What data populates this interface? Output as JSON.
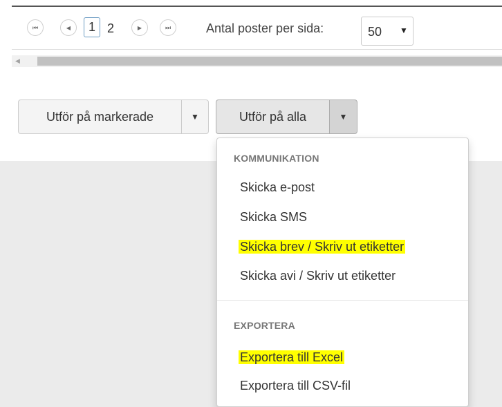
{
  "pager": {
    "first_label": "⏮",
    "prev_label": "◀",
    "page_current": "1",
    "page_next": "2",
    "next_label": "▶",
    "last_label": "⏭",
    "page_size_label": "Antal poster per sida:",
    "page_size_value": "50",
    "page_size_caret": "▼"
  },
  "scrollbar": {
    "left_arrow": "◀"
  },
  "actions": {
    "marked_label": "Utför på markerade",
    "marked_caret": "▼",
    "all_label": "Utför på alla",
    "all_caret": "▼"
  },
  "dropdown": {
    "sections": [
      {
        "header": "KOMMUNIKATION",
        "items": [
          "Skicka e-post",
          "Skicka SMS",
          "Skicka brev / Skriv ut etiketter",
          "Skicka avi / Skriv ut etiketter"
        ]
      },
      {
        "header": "EXPORTERA",
        "items": [
          "Exportera till Excel",
          "Exportera till CSV-fil"
        ]
      }
    ],
    "highlight_color": "#ffff00"
  },
  "colors": {
    "panel_bg": "#ffffff",
    "page_bg": "#ebebeb",
    "accent_border": "#6b9bc2"
  }
}
